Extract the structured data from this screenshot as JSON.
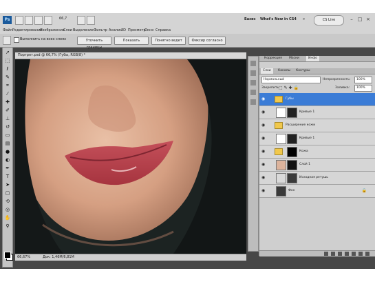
{
  "app": {
    "logo": "Ps"
  },
  "menu": [
    "Файл",
    "Редактирование",
    "Изображение",
    "Слои",
    "Выделение",
    "Фильтр",
    "Анализ",
    "3D",
    "Просмотр",
    "Окно",
    "Справка"
  ],
  "zoom_select": "66,7",
  "workspace": {
    "label1": "Базис",
    "label2": "What's New in CS4",
    "more": "»"
  },
  "cs_live": "CS Live",
  "window_controls": [
    "–",
    "□",
    "×"
  ],
  "options": {
    "checkbox_label": "Выполнить на всех слоях",
    "buttons": [
      "Уточнить границы",
      "Показать",
      "Понятно ведет",
      "Фиксир согласно"
    ]
  },
  "document": {
    "tab_title": "Портрет.psd @ 66,7% (Губы, RGB/8) *",
    "status_zoom": "66,67%",
    "status_doc": "Док: 1,46M/6,81M"
  },
  "panels": {
    "top_tabs": [
      "Коррекция",
      "Маски",
      "Инфо"
    ],
    "layer_tabs": [
      "Слои",
      "Каналы",
      "Контуры"
    ],
    "blend_mode": "Нормальный",
    "opacity_label": "Непрозрачность:",
    "opacity_value": "100%",
    "lock_label": "Закрепить:",
    "fill_label": "Заливка:",
    "fill_value": "100%"
  },
  "layers": [
    {
      "name": "Губы",
      "type": "group",
      "selected": true
    },
    {
      "name": "Кривые 1",
      "type": "adjustment",
      "selected": false
    },
    {
      "name": "Расширение кожи",
      "type": "group",
      "selected": false
    },
    {
      "name": "Кривые 1",
      "type": "adjustment",
      "selected": false
    },
    {
      "name": "Кожа",
      "type": "group",
      "selected": false
    },
    {
      "name": "Слой 1",
      "type": "pixel",
      "selected": false
    },
    {
      "name": "Исходная ретушь",
      "type": "pixel",
      "selected": false
    },
    {
      "name": "Фон",
      "type": "background",
      "selected": false
    }
  ],
  "icons": {
    "eye": "eye-icon",
    "lock": "lock-icon",
    "folder": "folder-icon"
  },
  "colors": {
    "selected_layer": "#3b7cd6",
    "panel_bg": "#cfcfcf",
    "frame_bg": "#474747"
  }
}
